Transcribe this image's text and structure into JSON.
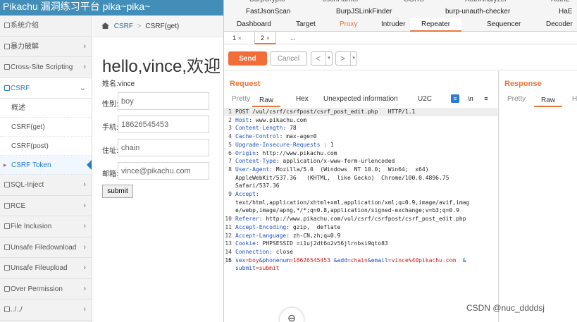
{
  "site": {
    "title": "Pikachu 漏洞练习平台 pika~pika~",
    "sidebar": [
      {
        "label": "系统介绍",
        "icon": "monitor-icon",
        "has_chevron": false
      },
      {
        "label": "暴力破解",
        "icon": "bolt-icon",
        "has_chevron": true
      },
      {
        "label": "Cross-Site Scripting",
        "icon": "code-icon",
        "has_chevron": true
      },
      {
        "label": "CSRF",
        "icon": "share-icon",
        "has_chevron": true,
        "open": true
      },
      {
        "label": "SQL-Inject",
        "icon": "database-icon",
        "has_chevron": true
      },
      {
        "label": "RCE",
        "icon": "terminal-icon",
        "has_chevron": true
      },
      {
        "label": "File Inclusion",
        "icon": "file-icon",
        "has_chevron": true
      },
      {
        "label": "Unsafe Filedownload",
        "icon": "download-icon",
        "has_chevron": true
      },
      {
        "label": "Unsafe Fileupload",
        "icon": "upload-icon",
        "has_chevron": true
      },
      {
        "label": "Over Permission",
        "icon": "lock-icon",
        "has_chevron": true
      },
      {
        "label": "../../",
        "icon": "folder-icon",
        "has_chevron": true
      }
    ],
    "csrf_sub": [
      "概述",
      "CSRF(get)",
      "CSRF(post)",
      "CSRF Token"
    ],
    "csrf_sub_active": 3,
    "breadcrumb": {
      "link": "CSRF",
      "sep": ">",
      "current": "CSRF(get)"
    },
    "greeting": "hello,vince,欢迎",
    "name_label": "姓名:vince",
    "fields": [
      {
        "label": "性别:",
        "value": "boy"
      },
      {
        "label": "手机:",
        "value": "18626545453"
      },
      {
        "label": "住址:",
        "value": "chain"
      },
      {
        "label": "邮箱:",
        "value": "vince@pikachu.com"
      }
    ],
    "submit_label": "submit"
  },
  "burp": {
    "extension_tabs_cut": [
      "BurpCrypto",
      "JsonHunter",
      "CORS",
      "AuthAnalyzer",
      "AuthZ"
    ],
    "extension_tabs": [
      "FastJsonScan",
      "BurpJSLinkFinder",
      "burp-unauth-checker",
      "HaE"
    ],
    "tool_tabs": [
      "Dashboard",
      "Target",
      "Proxy",
      "Intruder",
      "Repeater",
      "Sequencer",
      "Decoder"
    ],
    "active_tool": "Repeater",
    "repeater_tabs": [
      {
        "label": "1",
        "close": "×"
      },
      {
        "label": "2",
        "close": "×"
      },
      {
        "label": "...",
        "close": ""
      }
    ],
    "send_label": "Send",
    "cancel_label": "Cancel",
    "nav_back": "<",
    "nav_forward": ">",
    "nav_dropdown": "▾",
    "request": {
      "title": "Request",
      "tabs": [
        "Pretty",
        "Raw",
        "Hex",
        "Unexpected information",
        "U2C"
      ],
      "active_tab": "Raw",
      "icons": [
        "wrap-icon",
        "newline-icon",
        "menu-icon"
      ],
      "icon_glyphs": [
        "≡",
        "\\n",
        "≡"
      ],
      "lines": [
        {
          "n": "1",
          "k": "",
          "v": "POST /vul/csrf/csrfpost/csrf_post_edit.php   HTTP/1.1",
          "hl": true
        },
        {
          "n": "2",
          "k": "Host",
          "v": ": www.pikachu.com"
        },
        {
          "n": "3",
          "k": "Content-Length",
          "v": ": 78"
        },
        {
          "n": "4",
          "k": "Cache-Control",
          "v": ": max-age=0"
        },
        {
          "n": "5",
          "k": "Upgrade-Insecure-Requests",
          "v": " : 1"
        },
        {
          "n": "6",
          "k": "Origin",
          "v": ": http://www.pikachu.com"
        },
        {
          "n": "7",
          "k": "Content-Type",
          "v": ": application/x-www-form-urlencoded"
        },
        {
          "n": "8",
          "k": "User-Agent",
          "v": ": Mozilla/5.0  (Windows  NT 10.0;  Win64;  x64)"
        },
        {
          "n": "",
          "k": "",
          "v": "AppleWebKit/537.36   (KHTML,  like Gecko)  Chrome/100.0.4896.75"
        },
        {
          "n": "",
          "k": "",
          "v": "Safari/537.36"
        },
        {
          "n": "9",
          "k": "Accept",
          "v": ":"
        },
        {
          "n": "",
          "k": "",
          "v": "text/html,application/xhtml+xml,application/xml;q=0.9,image/avif,imag"
        },
        {
          "n": "",
          "k": "",
          "v": "e/webp,image/apng,*/*;q=0.8,application/signed-exchange;v=b3;q=0.9"
        },
        {
          "n": "10",
          "k": "Referer",
          "v": ": http://www.pikachu.com/vul/csrf/csrfpost/csrf_post_edit.php"
        },
        {
          "n": "11",
          "k": "Accept-Encoding",
          "v": ": gzip,  deflate"
        },
        {
          "n": "12",
          "k": "Accept-Language",
          "v": ": zh-CN,zh;q=0.9"
        },
        {
          "n": "13",
          "k": "Cookie",
          "v": ": PHPSESSID =i1uj2dt6o2v56jlrnbsi9qto83"
        },
        {
          "n": "14",
          "k": "Connection",
          "v": ": close"
        },
        {
          "n": "15",
          "k": "",
          "v": ""
        },
        {
          "n": "16",
          "k": "",
          "v": "",
          "body": true
        },
        {
          "n": "",
          "k": "",
          "v": "",
          "body2": true
        }
      ],
      "body_params": [
        {
          "k": "sex",
          "v": "=boy"
        },
        {
          "k": "&phonenum",
          "v": "=18626545453"
        },
        {
          "k": " &add",
          "v": "=chain"
        },
        {
          "k": "&email",
          "v": "=vince%40pikachu.com"
        },
        {
          "k": "  &",
          "v": ""
        }
      ],
      "body_params2": [
        {
          "k": "submit",
          "v": "=submit"
        }
      ]
    },
    "response": {
      "title": "Response",
      "tabs": [
        "Pretty",
        "Raw",
        "He"
      ],
      "active_tab": "Raw"
    },
    "floating_icon": "⊖"
  },
  "watermark": "CSDN @nuc_ddddsj",
  "colors": {
    "accent": "#e8773a",
    "site_header": "#438eb9",
    "key": "#1b4fc4",
    "value": "#d81b1b"
  }
}
